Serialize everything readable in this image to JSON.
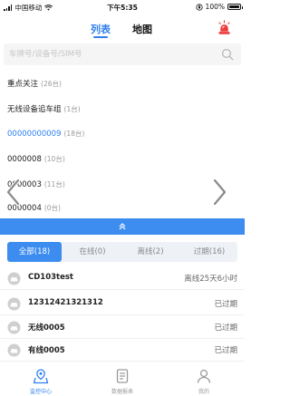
{
  "status_bar": {
    "carrier": "中国移动",
    "time": "下午5:35",
    "battery": "100%"
  },
  "header": {
    "tabs": [
      {
        "label": "列表",
        "active": true
      },
      {
        "label": "地图",
        "active": false
      }
    ],
    "alarm_icon": "siren-icon"
  },
  "search": {
    "placeholder": "车牌号/设备号/SIM号",
    "value": ""
  },
  "groups": [
    {
      "name": "重点关注",
      "count": "(26台)",
      "active": false
    },
    {
      "name": "无线设备追车组",
      "count": "(1台)",
      "active": false
    },
    {
      "name": "00000000009",
      "count": "(18台)",
      "active": true
    },
    {
      "name": "0000008",
      "count": "(10台)",
      "active": false
    },
    {
      "name": "0000003",
      "count": "(11台)",
      "active": false
    },
    {
      "name": "0000004",
      "count": "(0台)",
      "active": false
    }
  ],
  "filter_tabs": [
    {
      "label": "全部(18)",
      "active": true
    },
    {
      "label": "在线(0)",
      "active": false
    },
    {
      "label": "离线(2)",
      "active": false
    },
    {
      "label": "过期(16)",
      "active": false
    }
  ],
  "vehicles": [
    {
      "name": "CD103test",
      "status": "离线25天6小时"
    },
    {
      "name": "12312421321312",
      "status": "已过期"
    },
    {
      "name": "无线0005",
      "status": "已过期"
    },
    {
      "name": "有线0005",
      "status": "已过期"
    }
  ],
  "bottom_nav": [
    {
      "label": "监控中心",
      "active": true
    },
    {
      "label": "数据报表",
      "active": false
    },
    {
      "label": "我的",
      "active": false
    }
  ],
  "colors": {
    "accent": "#2f80ed",
    "collapse_bar": "#3d8cf0",
    "alarm": "#ee3b3b"
  }
}
